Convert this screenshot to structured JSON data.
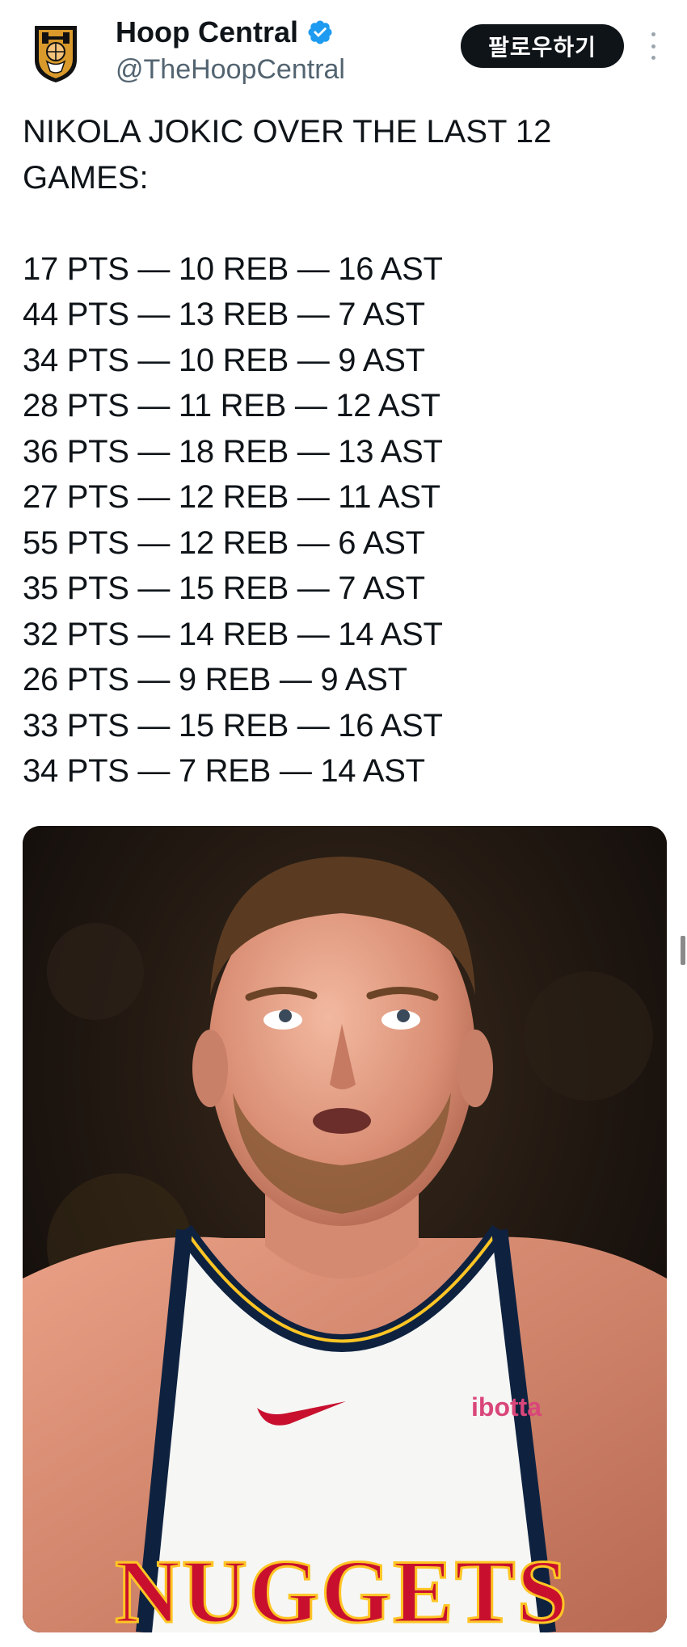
{
  "account": {
    "display_name": "Hoop Central",
    "handle": "@TheHoopCentral",
    "verified": true,
    "avatar_icon": "hoop-central-shield-logo"
  },
  "actions": {
    "follow_label": "팔로우하기",
    "more_icon": "vertical-ellipsis-icon"
  },
  "tweet": {
    "headline": "NIKOLA JOKIC OVER THE LAST 12 GAMES:",
    "stat_lines": [
      "17 PTS — 10 REB — 16 AST",
      "44 PTS — 13 REB — 7 AST",
      "34 PTS — 10 REB — 9 AST",
      "28 PTS — 11 REB — 12 AST",
      "36 PTS — 18 REB — 13 AST",
      "27 PTS — 12 REB — 11 AST",
      "55 PTS — 12 REB — 6 AST",
      "35 PTS — 15 REB — 7 AST",
      "32 PTS — 14 REB — 14 AST",
      "26 PTS — 9 REB — 9 AST",
      "33 PTS — 15 REB — 16 AST",
      "34 PTS — 7 REB — 14 AST"
    ]
  },
  "media": {
    "jersey_text": "NUGGETS",
    "sponsor_text": "ibotta"
  },
  "colors": {
    "follow_button_bg": "#0f1419",
    "verified_badge": "#1d9bf0",
    "handle_gray": "#536471",
    "jersey_navy": "#0e2240",
    "jersey_red": "#c8102e",
    "jersey_gold": "#fec524"
  }
}
